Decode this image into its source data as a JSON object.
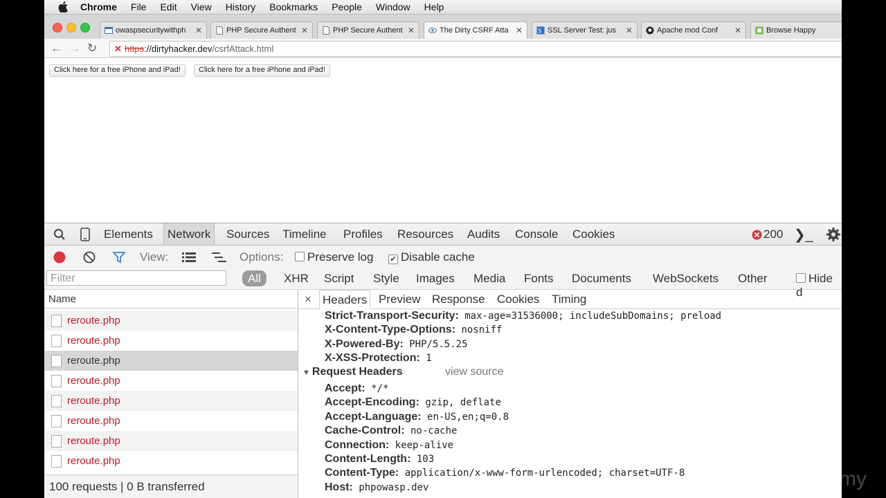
{
  "menubar": {
    "app": "Chrome",
    "items": [
      "File",
      "Edit",
      "View",
      "History",
      "Bookmarks",
      "People",
      "Window",
      "Help"
    ]
  },
  "tabs": [
    {
      "title": "owaspsecuritywithph",
      "active": false
    },
    {
      "title": "PHP Secure Authent",
      "active": false
    },
    {
      "title": "PHP Secure Authent",
      "active": false
    },
    {
      "title": "The Dirty CSRF Atta",
      "active": true
    },
    {
      "title": "SSL Server Test: jus",
      "active": false
    },
    {
      "title": "Apache mod Conf",
      "active": false
    },
    {
      "title": "Browse Happy",
      "active": false
    }
  ],
  "address": {
    "scheme": "https",
    "host": "://dirtyhacker.dev",
    "path": "/csrfAttack.html"
  },
  "page": {
    "buttons": [
      "Click here for a free iPhone and iPad!",
      "Click here for a free iPhone and iPad!"
    ]
  },
  "devtools": {
    "tabs": [
      "Elements",
      "Network",
      "Sources",
      "Timeline",
      "Profiles",
      "Resources",
      "Audits",
      "Console",
      "Cookies"
    ],
    "selected_tab": "Network",
    "error_count": "200",
    "view_label": "View:",
    "options_label": "Options:",
    "preserve_log": "Preserve log",
    "disable_cache": "Disable cache",
    "filter_placeholder": "Filter",
    "filter_types": [
      "All",
      "XHR",
      "Script",
      "Style",
      "Images",
      "Media",
      "Fonts",
      "Documents",
      "WebSockets",
      "Other"
    ],
    "hide_label": "Hide d",
    "name_header": "Name",
    "requests": [
      {
        "name": "reroute.php",
        "color": "#c0172a",
        "selected": false
      },
      {
        "name": "reroute.php",
        "color": "#c0172a",
        "selected": false
      },
      {
        "name": "reroute.php",
        "color": "#333333",
        "selected": true
      },
      {
        "name": "reroute.php",
        "color": "#c0172a",
        "selected": false
      },
      {
        "name": "reroute.php",
        "color": "#c0172a",
        "selected": false
      },
      {
        "name": "reroute.php",
        "color": "#c0172a",
        "selected": false
      },
      {
        "name": "reroute.php",
        "color": "#c0172a",
        "selected": false
      },
      {
        "name": "reroute.php",
        "color": "#c0172a",
        "selected": false
      }
    ],
    "footer": "100 requests  |  0 B transferred",
    "detail_close": "×",
    "detail_tabs": [
      "Headers",
      "Preview",
      "Response",
      "Cookies",
      "Timing"
    ],
    "response_headers": [
      {
        "k": "Strict-Transport-Security:",
        "v": "max-age=31536000; includeSubDomains; preload"
      },
      {
        "k": "X-Content-Type-Options:",
        "v": "nosniff"
      },
      {
        "k": "X-Powered-By:",
        "v": "PHP/5.5.25"
      },
      {
        "k": "X-XSS-Protection:",
        "v": "1"
      }
    ],
    "request_section": "Request Headers",
    "view_source": "view source",
    "request_headers": [
      {
        "k": "Accept:",
        "v": "*/*"
      },
      {
        "k": "Accept-Encoding:",
        "v": "gzip, deflate"
      },
      {
        "k": "Accept-Language:",
        "v": "en-US,en;q=0.8"
      },
      {
        "k": "Cache-Control:",
        "v": "no-cache"
      },
      {
        "k": "Connection:",
        "v": "keep-alive"
      },
      {
        "k": "Content-Length:",
        "v": "103"
      },
      {
        "k": "Content-Type:",
        "v": "application/x-www-form-urlencoded; charset=UTF-8"
      },
      {
        "k": "Host:",
        "v": "phpowasp.dev"
      }
    ]
  },
  "watermark": "my"
}
